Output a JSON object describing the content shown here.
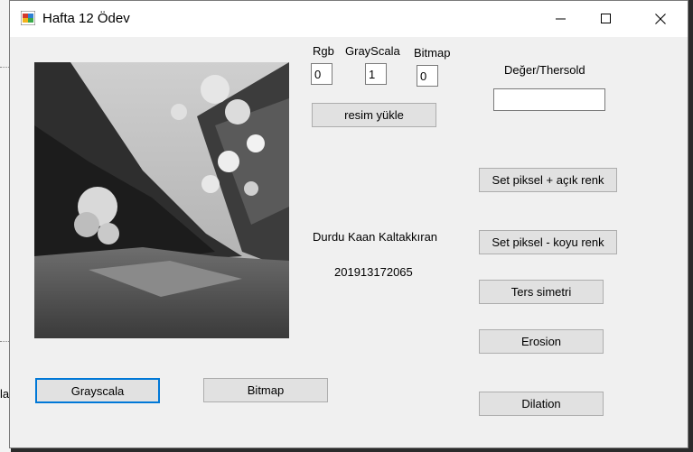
{
  "window": {
    "title": "Hafta 12 Ödev"
  },
  "background": {
    "partial_text": "la"
  },
  "labels": {
    "rgb": "Rgb",
    "grayscala": "GrayScala",
    "bitmap": "Bitmap",
    "threshold": "Değer/Thersold",
    "author_name": "Durdu Kaan Kaltakkıran",
    "student_no": "201913172065"
  },
  "fields": {
    "rgb_value": "0",
    "grayscala_value": "1",
    "bitmap_value": "0",
    "threshold_value": ""
  },
  "buttons": {
    "load_image": "resim yükle",
    "set_pixel_light": "Set piksel + açık renk",
    "set_pixel_dark": "Set piksel - koyu renk",
    "reverse_symmetry": "Ters simetri",
    "erosion": "Erosion",
    "dilation": "Dilation",
    "grayscala": "Grayscala",
    "bitmap": "Bitmap"
  },
  "image": {
    "description_icon": "grayscale-landscape-photo"
  },
  "colors": {
    "focus": "#0078d7",
    "window_bg": "#f0f0f0",
    "button_bg": "#e1e1e1"
  }
}
